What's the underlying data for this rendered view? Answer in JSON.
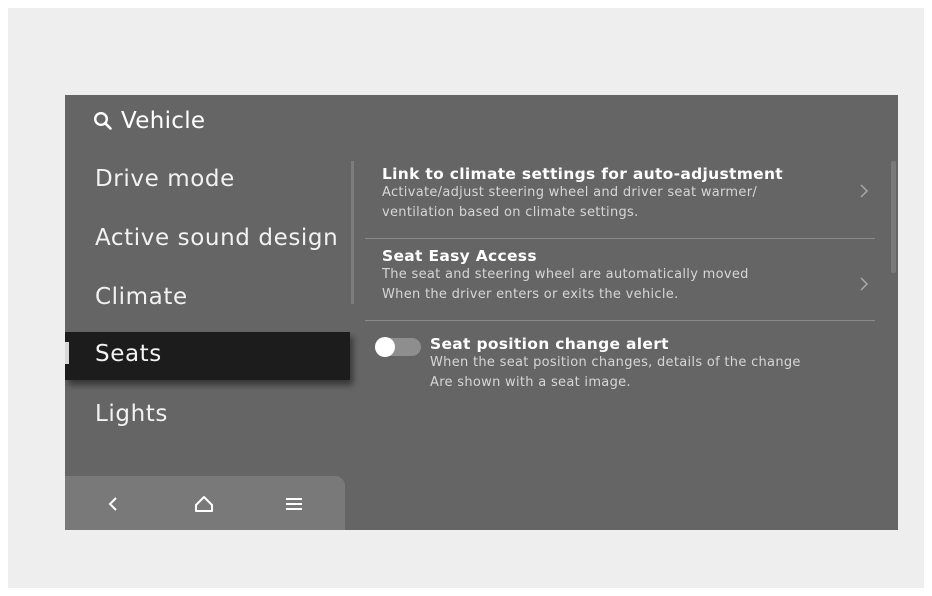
{
  "header": {
    "title": "Vehicle",
    "icon": "search-icon"
  },
  "sidebar": {
    "items": [
      {
        "label": "Drive mode"
      },
      {
        "label": "Active sound design"
      },
      {
        "label": "Climate"
      },
      {
        "label": "Seats",
        "selected": true
      },
      {
        "label": "Lights"
      }
    ]
  },
  "bottom_nav": {
    "back_icon": "chevron-left-icon",
    "home_icon": "home-icon",
    "menu_icon": "menu-icon"
  },
  "settings": [
    {
      "title": "Link to climate settings for auto-adjustment",
      "desc_line1": "Activate/adjust steering wheel and driver seat warmer/",
      "desc_line2": "ventilation based on climate settings."
    },
    {
      "title": "Seat Easy Access",
      "desc_line1": "The seat and steering wheel are automatically moved",
      "desc_line2": "When the driver enters or exits the vehicle."
    },
    {
      "title": "Seat position change alert",
      "desc_line1": "When the seat position changes, details of the change",
      "desc_line2": "Are shown with a seat image.",
      "toggle_on": false
    }
  ],
  "colors": {
    "screen_bg": "#656565",
    "selected_bg": "#1c1c1c",
    "bottom_nav_bg": "#797979",
    "text": "#ffffff"
  }
}
